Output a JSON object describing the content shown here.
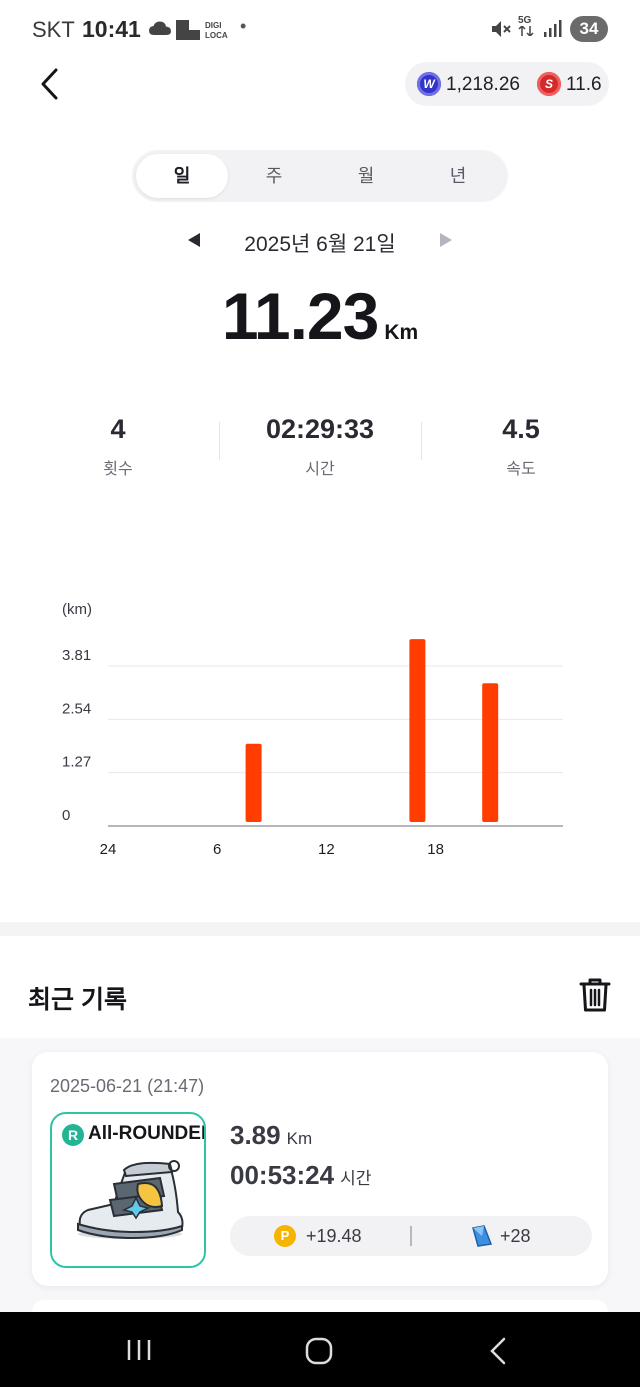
{
  "status_bar": {
    "carrier": "SKT",
    "time": "10:41",
    "app_label_top": "DIGI",
    "app_label_bottom": "LOCA",
    "dot": "•",
    "network": "5G",
    "battery": "34"
  },
  "header": {
    "coin_w_value": "1,218.26",
    "coin_s_value": "11.6",
    "coin_w_glyph": "W",
    "coin_s_glyph": "S"
  },
  "tabs": [
    {
      "label": "일",
      "active": true
    },
    {
      "label": "주",
      "active": false
    },
    {
      "label": "월",
      "active": false
    },
    {
      "label": "년",
      "active": false
    }
  ],
  "date": {
    "label": "2025년 6월 21일",
    "prev_icon": "triangle-left",
    "next_icon": "triangle-right"
  },
  "distance": {
    "value": "11.23",
    "unit": "Km"
  },
  "stats": [
    {
      "value": "4",
      "label": "횟수"
    },
    {
      "value": "02:29:33",
      "label": "시간"
    },
    {
      "value": "4.5",
      "label": "속도"
    }
  ],
  "chart_data": {
    "type": "bar",
    "ylabel": "(km)",
    "yticks": [
      "0",
      "1.27",
      "2.54",
      "3.81"
    ],
    "ytick_values": [
      0,
      1.27,
      2.54,
      3.81
    ],
    "xticks": [
      "24",
      "6",
      "12",
      "18"
    ],
    "xtick_values": [
      0,
      6,
      12,
      18
    ],
    "x": [
      8,
      17,
      21
    ],
    "values": [
      1.96,
      4.45,
      3.4
    ],
    "ylim": [
      0,
      3.81
    ],
    "xlim": [
      0,
      23
    ],
    "bar_color": "#ff3d00",
    "grid": true
  },
  "recent": {
    "title": "최근 기록",
    "trash_icon": "trash-icon"
  },
  "record": {
    "date": "2025-06-21 (21:47)",
    "shoe_badge": "R",
    "shoe_type": "All-ROUNDER",
    "distance_value": "3.89",
    "distance_unit": "Km",
    "time_value": "00:53:24",
    "time_unit": "시간",
    "reward_coin": "P",
    "reward_points": "+19.48",
    "reward_map": "+28"
  },
  "colors": {
    "accent_bar": "#ff3d00",
    "shoe_border": "#2ec4a8",
    "coin_p": "#f5b400"
  }
}
